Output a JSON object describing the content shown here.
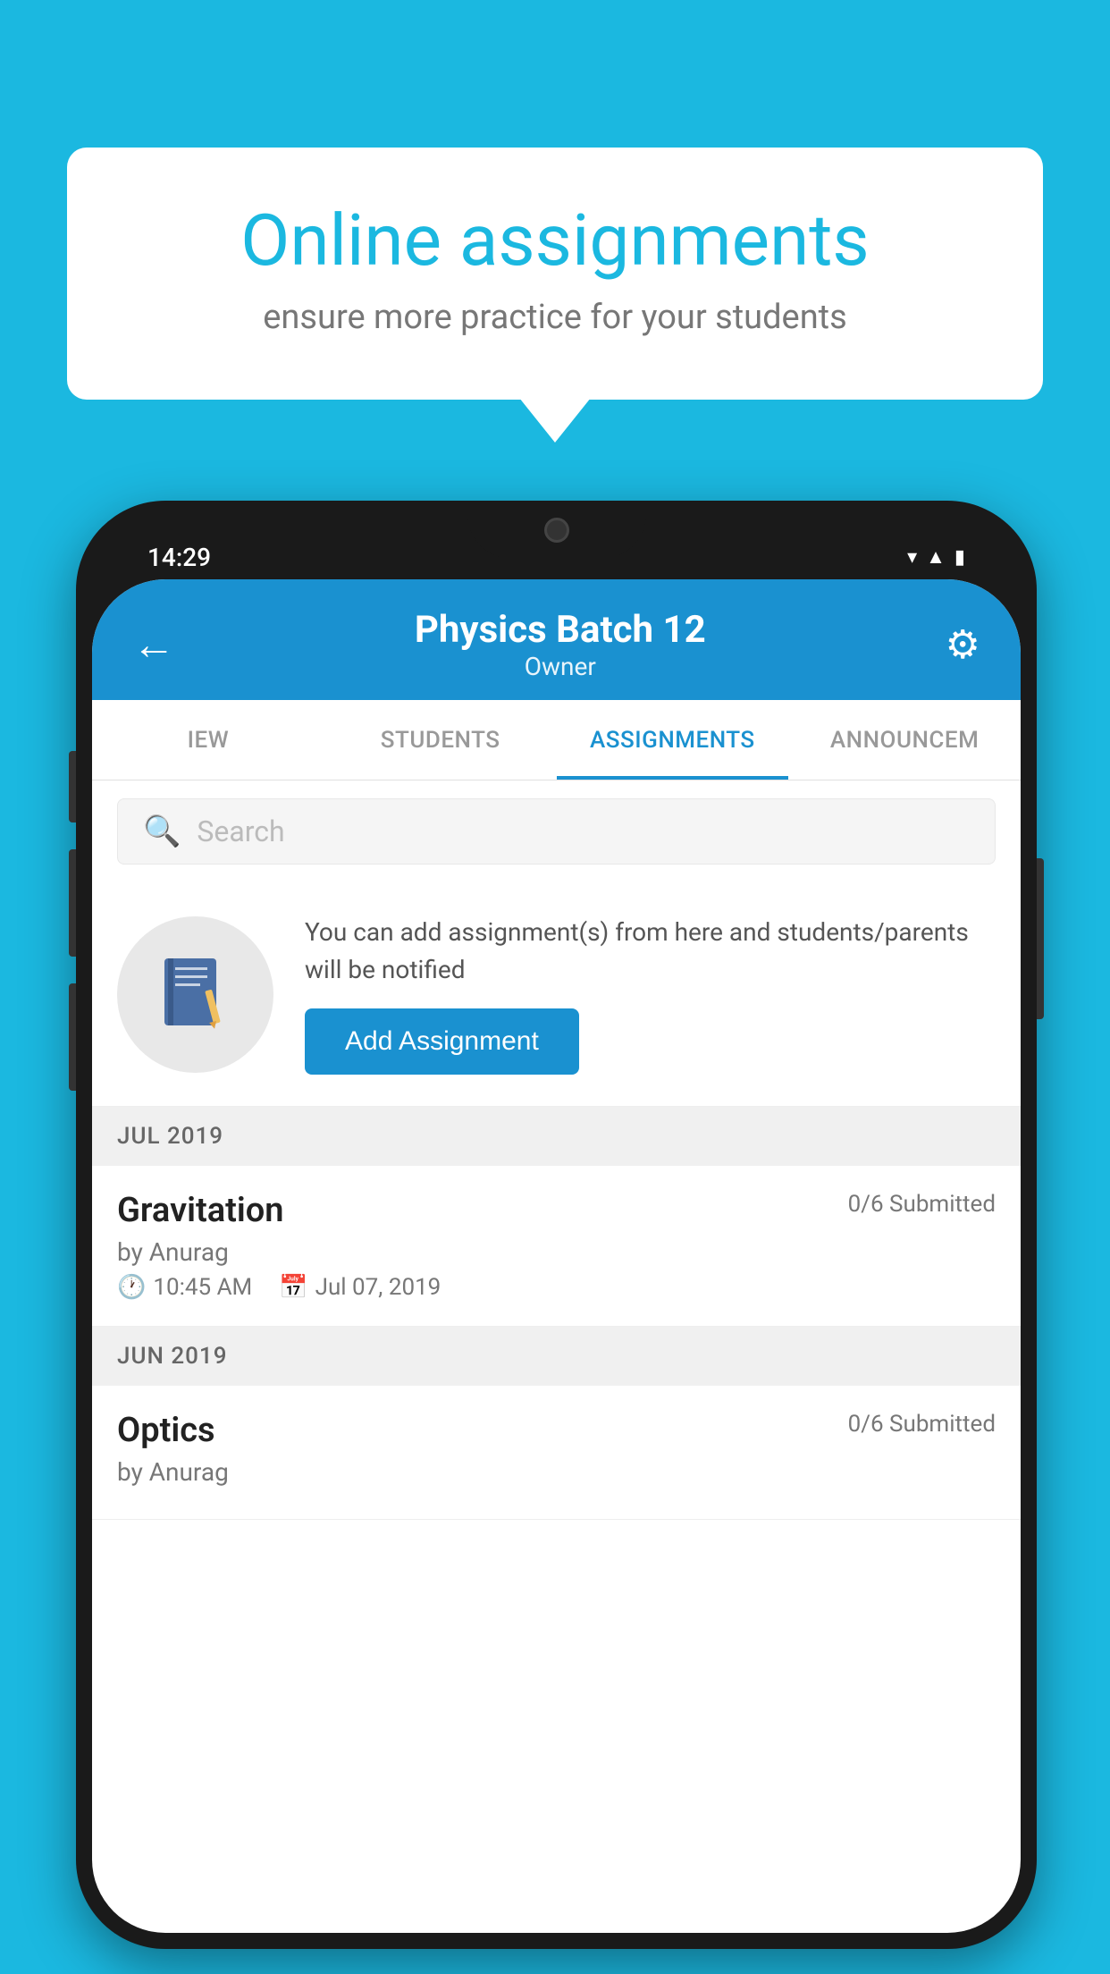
{
  "background_color": "#1bb8e0",
  "speech_bubble": {
    "title": "Online assignments",
    "subtitle": "ensure more practice for your students"
  },
  "phone": {
    "status_bar": {
      "time": "14:29",
      "icons": [
        "wifi",
        "signal",
        "battery"
      ]
    },
    "header": {
      "title": "Physics Batch 12",
      "subtitle": "Owner",
      "back_label": "←",
      "gear_label": "⚙"
    },
    "tabs": [
      {
        "label": "IEW",
        "active": false
      },
      {
        "label": "STUDENTS",
        "active": false
      },
      {
        "label": "ASSIGNMENTS",
        "active": true
      },
      {
        "label": "ANNOUNCEM",
        "active": false
      }
    ],
    "search": {
      "placeholder": "Search"
    },
    "promo": {
      "text": "You can add assignment(s) from here and students/parents will be notified",
      "button_label": "Add Assignment"
    },
    "sections": [
      {
        "label": "JUL 2019",
        "assignments": [
          {
            "name": "Gravitation",
            "submitted": "0/6 Submitted",
            "by": "by Anurag",
            "time": "10:45 AM",
            "date": "Jul 07, 2019"
          }
        ]
      },
      {
        "label": "JUN 2019",
        "assignments": [
          {
            "name": "Optics",
            "submitted": "0/6 Submitted",
            "by": "by Anurag",
            "time": "",
            "date": ""
          }
        ]
      }
    ]
  }
}
